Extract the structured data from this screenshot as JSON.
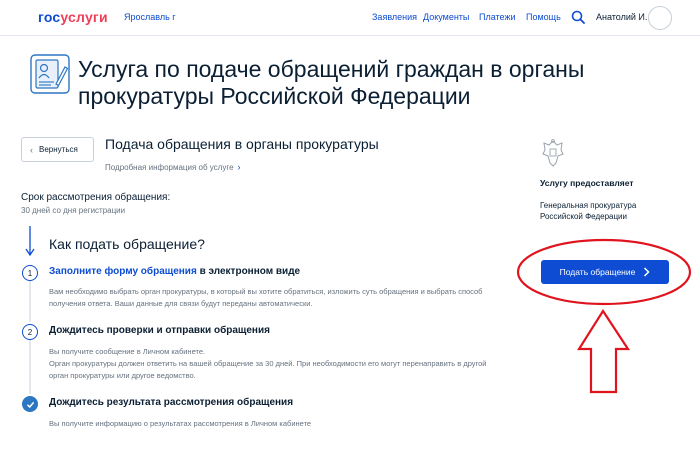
{
  "header": {
    "logo_part1": "гос",
    "logo_part2": "услуги",
    "region": "Ярославль г",
    "nav": [
      "Заявления",
      "Документы",
      "Платежи",
      "Помощь"
    ],
    "user_name": "Анатолий И."
  },
  "page_title": "Услуга по подаче обращений граждан в органы прокуратуры Российской Федерации",
  "back_label": "Вернуться",
  "section_title": "Подача обращения в органы прокуратуры",
  "more_info": "Подробная информация об услуге",
  "term": {
    "label": "Срок рассмотрения обращения:",
    "value": "30 дней со дня регистрации"
  },
  "how_title": "Как подать обращение?",
  "steps": [
    {
      "number": "1",
      "title_link": "Заполните форму обращения",
      "title_rest": " в электронном виде",
      "text": "Вам необходимо выбрать орган прокуратуры, в который вы хотите обратиться, изложить суть обращения и выбрать способ получения ответа. Ваши данные для связи будут переданы автоматически."
    },
    {
      "number": "2",
      "title": "Дождитесь проверки и отправки обращения",
      "text1": "Вы получите сообщение в Личном кабинете.",
      "text2": "Орган прокуратуры должен ответить на вашей обращение за 30 дней. При необходимости его могут перенаправить в другой орган прокуратуры или другое ведомство."
    },
    {
      "title": "Дождитесь результата рассмотрения обращения",
      "text": "Вы получите информацию о результатах рассмотрения в Личном кабинете"
    }
  ],
  "provider": {
    "label": "Услугу предоставляет",
    "name": "Генеральная прокуратура Российской Федерации"
  },
  "submit_label": "Подать обращение",
  "colors": {
    "brand_blue": "#0d4cd3",
    "brand_red": "#ee3f58",
    "annotation_red": "#e0141e"
  }
}
